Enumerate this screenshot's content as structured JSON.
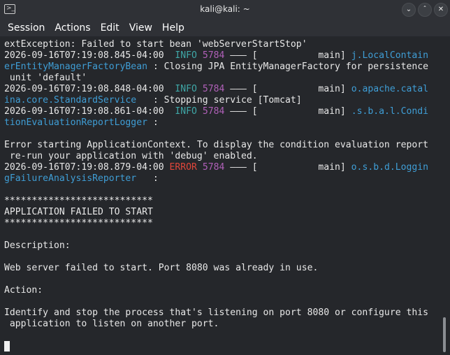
{
  "window": {
    "title": "kali@kali: ~",
    "app_icon": "terminal-icon",
    "buttons": {
      "minimize": "minimize-icon",
      "maximize": "maximize-icon",
      "close": "close-icon"
    }
  },
  "menu": [
    "Session",
    "Actions",
    "Edit",
    "View",
    "Help"
  ],
  "colors": {
    "info": "#3fa7a7",
    "error": "#e0463a",
    "pid": "#b060b8",
    "logger": "#3f9ed6"
  },
  "terminal": {
    "lines": [
      [
        {
          "t": "extException: Failed to start bean 'webServerStartStop'"
        }
      ],
      [
        {
          "t": "2026-09-16T07:19:08.845-04:00  "
        },
        {
          "t": "INFO",
          "c": "lvl-info"
        },
        {
          "t": " "
        },
        {
          "t": "5784",
          "c": "pid"
        },
        {
          "t": " ——— [           main] "
        },
        {
          "t": "j.LocalContain",
          "c": "logger"
        }
      ],
      [
        {
          "t": "erEntityManagerFactoryBean",
          "c": "logger"
        },
        {
          "t": " : Closing JPA EntityManagerFactory for persistence"
        }
      ],
      [
        {
          "t": " unit 'default'"
        }
      ],
      [
        {
          "t": "2026-09-16T07:19:08.848-04:00  "
        },
        {
          "t": "INFO",
          "c": "lvl-info"
        },
        {
          "t": " "
        },
        {
          "t": "5784",
          "c": "pid"
        },
        {
          "t": " ——— [           main] "
        },
        {
          "t": "o.apache.catal",
          "c": "logger"
        }
      ],
      [
        {
          "t": "ina.core.StandardService",
          "c": "logger"
        },
        {
          "t": "   : Stopping service [Tomcat]"
        }
      ],
      [
        {
          "t": "2026-09-16T07:19:08.861-04:00  "
        },
        {
          "t": "INFO",
          "c": "lvl-info"
        },
        {
          "t": " "
        },
        {
          "t": "5784",
          "c": "pid"
        },
        {
          "t": " ——— [           main] "
        },
        {
          "t": ".s.b.a.l.Condi",
          "c": "logger"
        }
      ],
      [
        {
          "t": "tionEvaluationReportLogger",
          "c": "logger"
        },
        {
          "t": " :"
        }
      ],
      [
        {
          "t": ""
        }
      ],
      [
        {
          "t": "Error starting ApplicationContext. To display the condition evaluation report"
        }
      ],
      [
        {
          "t": " re-run your application with 'debug' enabled."
        }
      ],
      [
        {
          "t": "2026-09-16T07:19:08.879-04:00 "
        },
        {
          "t": "ERROR",
          "c": "lvl-error"
        },
        {
          "t": " "
        },
        {
          "t": "5784",
          "c": "pid"
        },
        {
          "t": " ——— [           main] "
        },
        {
          "t": "o.s.b.d.Loggin",
          "c": "logger"
        }
      ],
      [
        {
          "t": "gFailureAnalysisReporter",
          "c": "logger"
        },
        {
          "t": "   :"
        }
      ],
      [
        {
          "t": ""
        }
      ],
      [
        {
          "t": "***************************"
        }
      ],
      [
        {
          "t": "APPLICATION FAILED TO START"
        }
      ],
      [
        {
          "t": "***************************"
        }
      ],
      [
        {
          "t": ""
        }
      ],
      [
        {
          "t": "Description:"
        }
      ],
      [
        {
          "t": ""
        }
      ],
      [
        {
          "t": "Web server failed to start. Port 8080 was already in use."
        }
      ],
      [
        {
          "t": ""
        }
      ],
      [
        {
          "t": "Action:"
        }
      ],
      [
        {
          "t": ""
        }
      ],
      [
        {
          "t": "Identify and stop the process that's listening on port 8080 or configure this"
        }
      ],
      [
        {
          "t": " application to listen on another port."
        }
      ]
    ]
  }
}
